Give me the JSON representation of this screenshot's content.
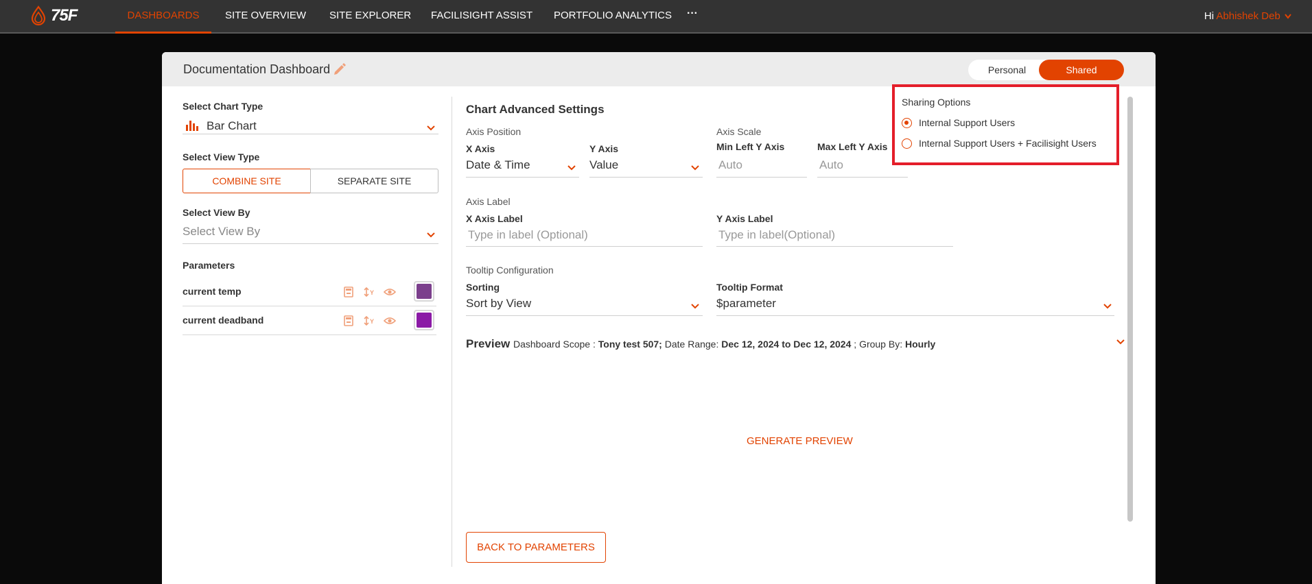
{
  "nav": {
    "logo_text": "75F",
    "items": [
      "DASHBOARDS",
      "SITE OVERVIEW",
      "SITE EXPLORER",
      "FACILISIGHT ASSIST",
      "PORTFOLIO ANALYTICS"
    ],
    "more": "···",
    "greeting": "Hi",
    "user_name": "Abhishek Deb"
  },
  "modal": {
    "title": "Documentation Dashboard",
    "toggle": {
      "personal": "Personal",
      "shared": "Shared"
    }
  },
  "left": {
    "chart_type_label": "Select Chart Type",
    "chart_type_value": "Bar Chart",
    "view_type_label": "Select View Type",
    "combine_site": "COMBINE SITE",
    "separate_site": "SEPARATE SITE",
    "view_by_label": "Select View By",
    "view_by_placeholder": "Select View By",
    "parameters_label": "Parameters",
    "parameters": [
      {
        "name": "current temp",
        "color": "#7b3f8c"
      },
      {
        "name": "current deadband",
        "color": "#8b1aa6"
      }
    ]
  },
  "advanced": {
    "title": "Chart Advanced Settings",
    "axis_position_label": "Axis Position",
    "x_axis_label": "X Axis",
    "x_axis_value": "Date & Time",
    "y_axis_label": "Y Axis",
    "y_axis_value": "Value",
    "axis_scale_label": "Axis Scale",
    "min_left_y_label": "Min Left Y Axis",
    "min_left_y_placeholder": "Auto",
    "max_left_y_label": "Max Left Y Axis",
    "max_left_y_placeholder": "Auto",
    "axis_label_label": "Axis Label",
    "x_axis_label_label": "X Axis Label",
    "x_axis_label_placeholder": "Type in label (Optional)",
    "y_axis_label_label": "Y Axis Label",
    "y_axis_label_placeholder": "Type in label(Optional)",
    "tooltip_config_label": "Tooltip Configuration",
    "sorting_label": "Sorting",
    "sorting_value": "Sort by View",
    "tooltip_format_label": "Tooltip Format",
    "tooltip_format_value": "$parameter"
  },
  "preview": {
    "title": "Preview",
    "scope_label": "Dashboard Scope :",
    "scope_value": "Tony test 507;",
    "date_label": "Date Range:",
    "date_value": "Dec 12, 2024 to Dec 12, 2024",
    "date_sep": ";",
    "group_label": "Group By:",
    "group_value": "Hourly",
    "generate": "GENERATE PREVIEW",
    "back": "BACK TO PARAMETERS"
  },
  "sharing": {
    "title": "Sharing Options",
    "options": [
      "Internal Support Users",
      "Internal Support Users + Facilisight Users"
    ],
    "selected_index": 0
  },
  "colors": {
    "accent": "#e24301",
    "highlight": "#e41e2a",
    "nav_bg": "#333333"
  }
}
